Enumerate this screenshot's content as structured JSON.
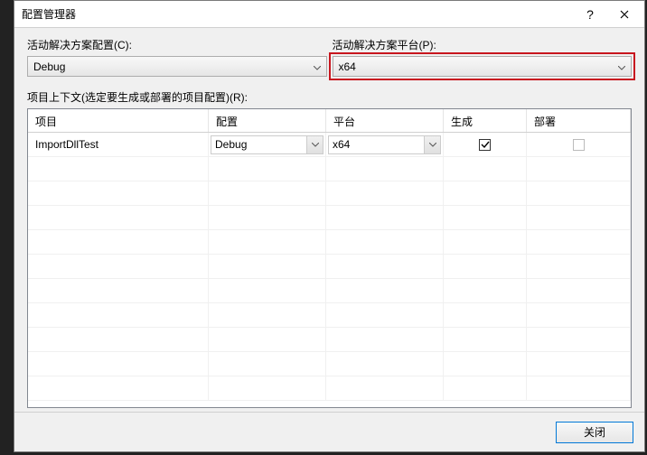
{
  "dialog": {
    "title": "配置管理器",
    "help": "?",
    "close_button": "×"
  },
  "labels": {
    "active_config": "活动解决方案配置(C):",
    "active_platform": "活动解决方案平台(P):",
    "context": "项目上下文(选定要生成或部署的项目配置)(R):"
  },
  "selects": {
    "active_config_value": "Debug",
    "active_platform_value": "x64"
  },
  "grid": {
    "headers": {
      "project": "项目",
      "config": "配置",
      "platform": "平台",
      "build": "生成",
      "deploy": "部署"
    },
    "rows": [
      {
        "project": "ImportDllTest",
        "config": "Debug",
        "platform": "x64",
        "build": true,
        "deploy": false,
        "deploy_enabled": false
      }
    ]
  },
  "footer": {
    "close": "关闭"
  }
}
